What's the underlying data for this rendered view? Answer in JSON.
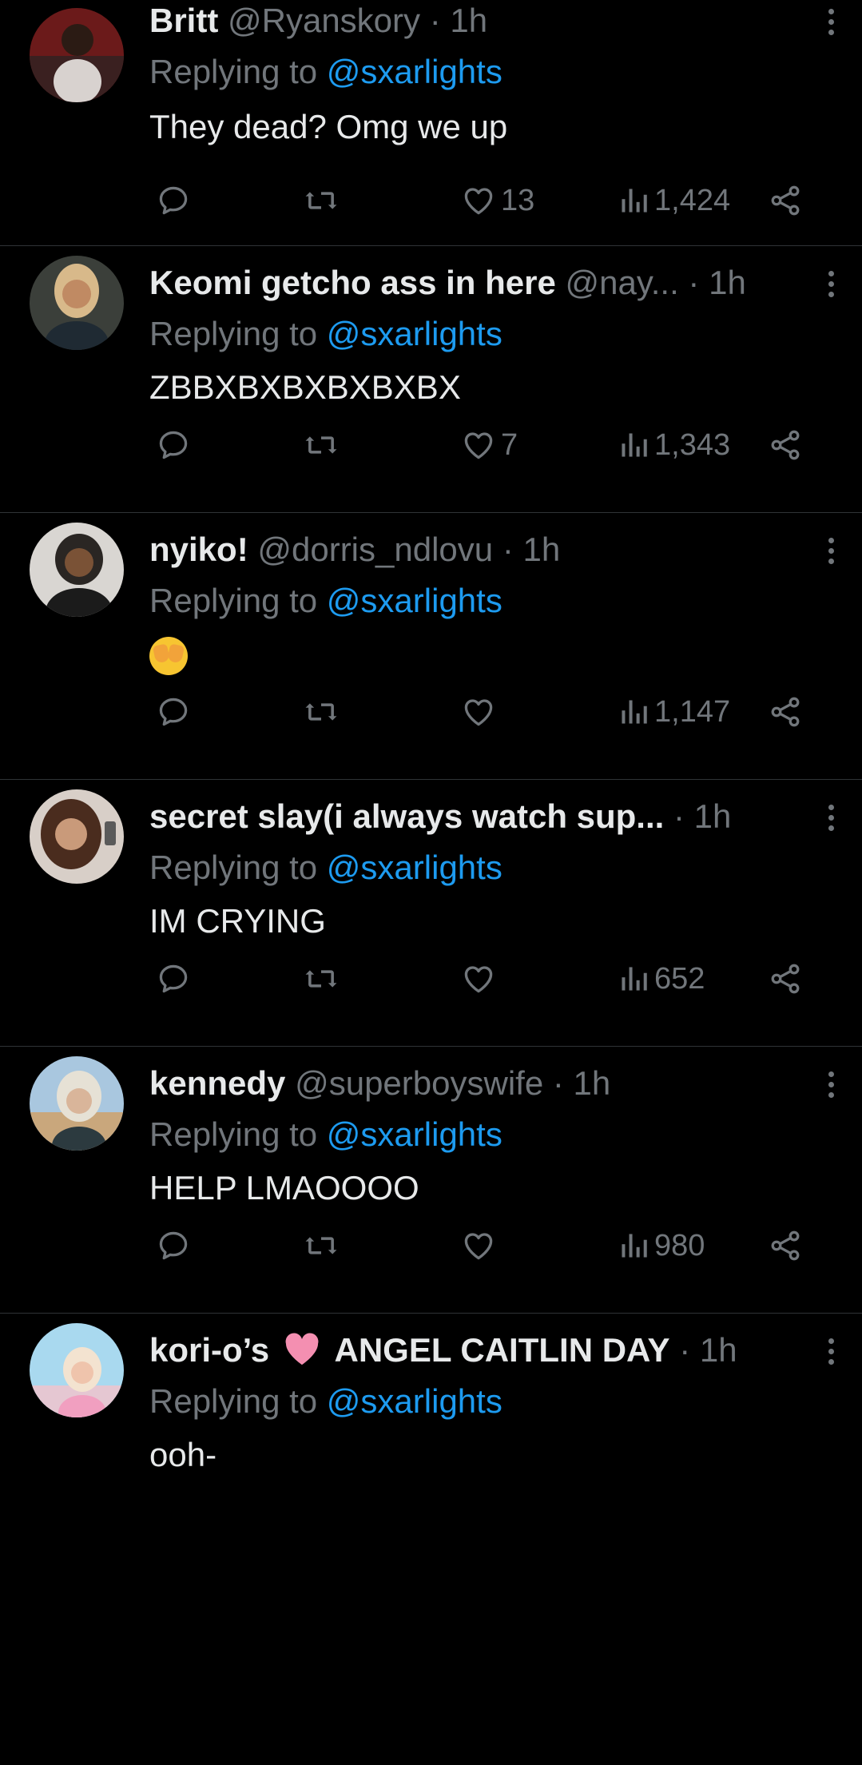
{
  "replies": [
    {
      "name": "Britt",
      "handle": "@Ryanskory",
      "time": "1h",
      "replying_prefix": "Replying to",
      "replying_to": "@sxarlights",
      "text": "They dead? Omg we up",
      "likes": "13",
      "views": "1,424",
      "avatar_colors": [
        "#6b1a1a",
        "#d8d2cf"
      ],
      "avatar_icon": "avatar-photo-icon"
    },
    {
      "name": "Keomi getcho ass in here",
      "handle": "@nay...",
      "time": "1h",
      "replying_prefix": "Replying to",
      "replying_to": "@sxarlights",
      "text": "ZBBXBXBXBXBXBX",
      "likes": "7",
      "views": "1,343",
      "avatar_colors": [
        "#3b3f3a",
        "#c08a63"
      ],
      "avatar_icon": "avatar-photo-icon"
    },
    {
      "name": "nyiko!",
      "handle": "@dorris_ndlovu",
      "time": "1h",
      "replying_prefix": "Replying to",
      "replying_to": "@sxarlights",
      "text": "🫣",
      "likes": "",
      "views": "1,147",
      "avatar_colors": [
        "#2a2623",
        "#7a5236"
      ],
      "avatar_icon": "avatar-photo-icon"
    },
    {
      "name": "secret slay(i always watch sup...",
      "handle": "",
      "time": "1h",
      "replying_prefix": "Replying to",
      "replying_to": "@sxarlights",
      "text": "IM CRYING",
      "likes": "",
      "views": "652",
      "avatar_colors": [
        "#d8cfc8",
        "#4a2c1e"
      ],
      "avatar_icon": "avatar-photo-icon"
    },
    {
      "name": "kennedy",
      "handle": "@superboyswife",
      "time": "1h",
      "replying_prefix": "Replying to",
      "replying_to": "@sxarlights",
      "text": "HELP LMAOOOO",
      "likes": "",
      "views": "980",
      "avatar_colors": [
        "#c9a77c",
        "#e6e1d5"
      ],
      "avatar_icon": "avatar-photo-icon"
    },
    {
      "name_part1": "kori-o’s",
      "name_part2": "ANGEL CAITLIN DAY",
      "time": "1h",
      "replying_prefix": "Replying to",
      "replying_to": "@sxarlights",
      "text": "ooh-",
      "avatar_colors": [
        "#e5c7d2",
        "#a9d9ef"
      ],
      "avatar_icon": "avatar-photo-icon"
    }
  ],
  "colors": {
    "background": "#000000",
    "text": "#e7e9ea",
    "muted": "#71767b",
    "link": "#1d9bf0",
    "divider": "#2f3336",
    "heart_emoji": "#f48fb1"
  },
  "separator": "·"
}
